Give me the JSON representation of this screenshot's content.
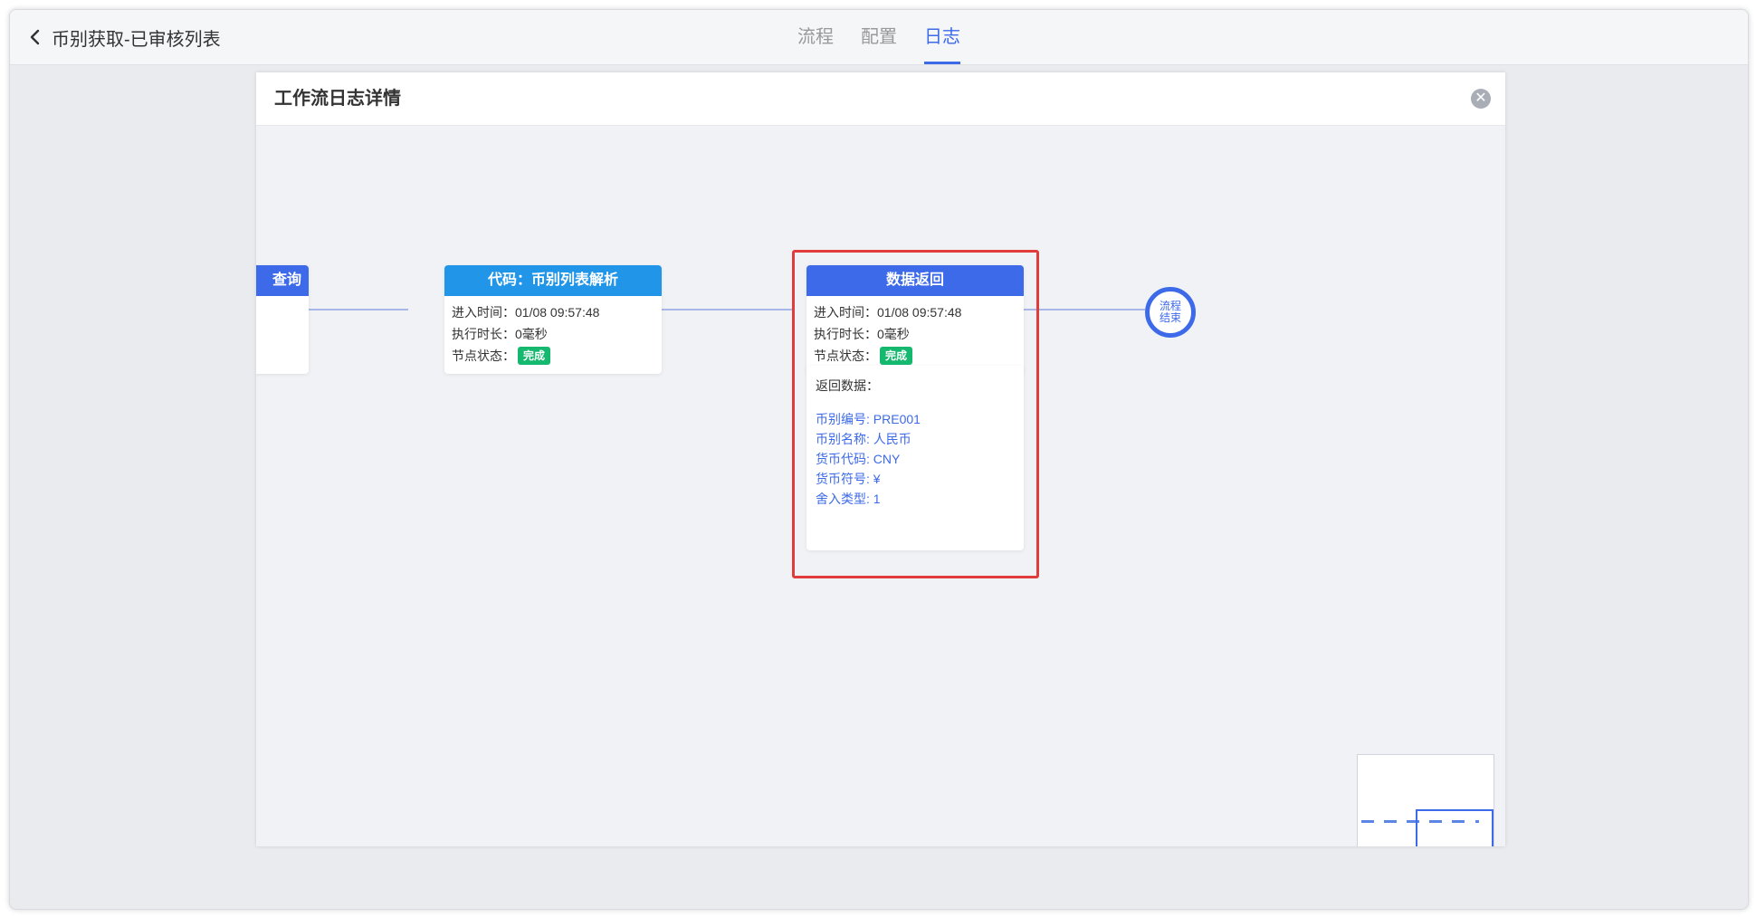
{
  "header": {
    "back_icon": "chevron-left-icon",
    "title": "币别获取-已审核列表",
    "tabs": [
      {
        "label": "流程",
        "active": false
      },
      {
        "label": "配置",
        "active": false
      },
      {
        "label": "日志",
        "active": true
      }
    ]
  },
  "dialog": {
    "title": "工作流日志详情",
    "close_icon": "close-circle-icon"
  },
  "nodes": [
    {
      "title": "查询",
      "partial": true
    },
    {
      "title": "代码：币别列表解析",
      "enter_label": "进入时间：",
      "enter_time": "01/08 09:57:48",
      "duration_label": "执行时长：",
      "duration": "0毫秒",
      "status_label": "节点状态：",
      "status": "完成"
    },
    {
      "title": "数据返回",
      "enter_label": "进入时间：",
      "enter_time": "01/08 09:57:48",
      "duration_label": "执行时长：",
      "duration": "0毫秒",
      "status_label": "节点状态：",
      "status": "完成"
    }
  ],
  "return_data": {
    "title": "返回数据：",
    "lines": [
      "币别编号: PRE001",
      "币别名称: 人民币",
      "货币代码: CNY",
      "货币符号: ¥",
      "舍入类型: 1"
    ]
  },
  "end_node": {
    "line1": "流程",
    "line2": "结束"
  },
  "colors": {
    "accent": "#3d6ae8",
    "node_head_blue": "#3d6ae8",
    "node_head_cyan": "#2196e8",
    "success": "#14b86e",
    "highlight": "#e03c3c"
  }
}
